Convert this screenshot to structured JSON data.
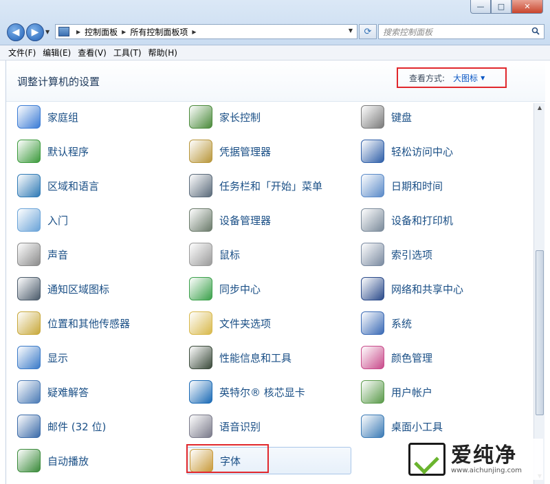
{
  "window": {
    "controls": {
      "minimize": "—",
      "maximize": "□",
      "close": "✕"
    }
  },
  "nav": {
    "back_glyph": "◀",
    "forward_glyph": "▶",
    "breadcrumbs": [
      "控制面板",
      "所有控制面板项"
    ],
    "search_placeholder": "搜索控制面板"
  },
  "menu": [
    "文件(F)",
    "编辑(E)",
    "查看(V)",
    "工具(T)",
    "帮助(H)"
  ],
  "header": {
    "title": "调整计算机的设置",
    "view_by_label": "查看方式:",
    "view_by_value": "大图标"
  },
  "items": [
    {
      "label": "家庭组",
      "icon": "homegroup-icon",
      "color": "#3a7bd5"
    },
    {
      "label": "家长控制",
      "icon": "parental-controls-icon",
      "color": "#4a8a3a"
    },
    {
      "label": "键盘",
      "icon": "keyboard-icon",
      "color": "#7a7a7a"
    },
    {
      "label": "默认程序",
      "icon": "default-programs-icon",
      "color": "#3c9a3c"
    },
    {
      "label": "凭据管理器",
      "icon": "credential-manager-icon",
      "color": "#b8963a"
    },
    {
      "label": "轻松访问中心",
      "icon": "ease-of-access-icon",
      "color": "#2f5fa8"
    },
    {
      "label": "区域和语言",
      "icon": "region-language-icon",
      "color": "#2f7ab5"
    },
    {
      "label": "任务栏和「开始」菜单",
      "icon": "taskbar-icon",
      "color": "#5a6a7a"
    },
    {
      "label": "日期和时间",
      "icon": "date-time-icon",
      "color": "#5a8ac8"
    },
    {
      "label": "入门",
      "icon": "getting-started-icon",
      "color": "#6aa3d8"
    },
    {
      "label": "设备管理器",
      "icon": "device-manager-icon",
      "color": "#6a7a6a"
    },
    {
      "label": "设备和打印机",
      "icon": "devices-printers-icon",
      "color": "#7a8a9a"
    },
    {
      "label": "声音",
      "icon": "sound-icon",
      "color": "#8a8a8a"
    },
    {
      "label": "鼠标",
      "icon": "mouse-icon",
      "color": "#9a9a9a"
    },
    {
      "label": "索引选项",
      "icon": "indexing-icon",
      "color": "#7a8aa0"
    },
    {
      "label": "通知区域图标",
      "icon": "notification-area-icon",
      "color": "#4a5a6a"
    },
    {
      "label": "同步中心",
      "icon": "sync-center-icon",
      "color": "#3aa04a"
    },
    {
      "label": "网络和共享中心",
      "icon": "network-sharing-icon",
      "color": "#2a4a8a"
    },
    {
      "label": "位置和其他传感器",
      "icon": "location-sensors-icon",
      "color": "#c8a83a"
    },
    {
      "label": "文件夹选项",
      "icon": "folder-options-icon",
      "color": "#d8b84a"
    },
    {
      "label": "系统",
      "icon": "system-icon",
      "color": "#3a6ab5"
    },
    {
      "label": "显示",
      "icon": "display-icon",
      "color": "#3a7ac8"
    },
    {
      "label": "性能信息和工具",
      "icon": "performance-icon",
      "color": "#3a4a3a"
    },
    {
      "label": "颜色管理",
      "icon": "color-management-icon",
      "color": "#c84a8a"
    },
    {
      "label": "疑难解答",
      "icon": "troubleshooting-icon",
      "color": "#4a7ab5"
    },
    {
      "label": "英特尔® 核芯显卡",
      "icon": "intel-graphics-icon",
      "color": "#1a6ab5"
    },
    {
      "label": "用户帐户",
      "icon": "user-accounts-icon",
      "color": "#5a9a4a"
    },
    {
      "label": "邮件 (32 位)",
      "icon": "mail-icon",
      "color": "#3a6aa8"
    },
    {
      "label": "语音识别",
      "icon": "speech-recognition-icon",
      "color": "#7a7a8a"
    },
    {
      "label": "桌面小工具",
      "icon": "desktop-gadgets-icon",
      "color": "#3a7ab5"
    },
    {
      "label": "自动播放",
      "icon": "autoplay-icon",
      "color": "#3a8a3a"
    },
    {
      "label": "字体",
      "icon": "fonts-icon",
      "color": "#c89a3a"
    }
  ],
  "watermark": {
    "brand": "爱纯净",
    "url": "www.aichunjing.com"
  }
}
